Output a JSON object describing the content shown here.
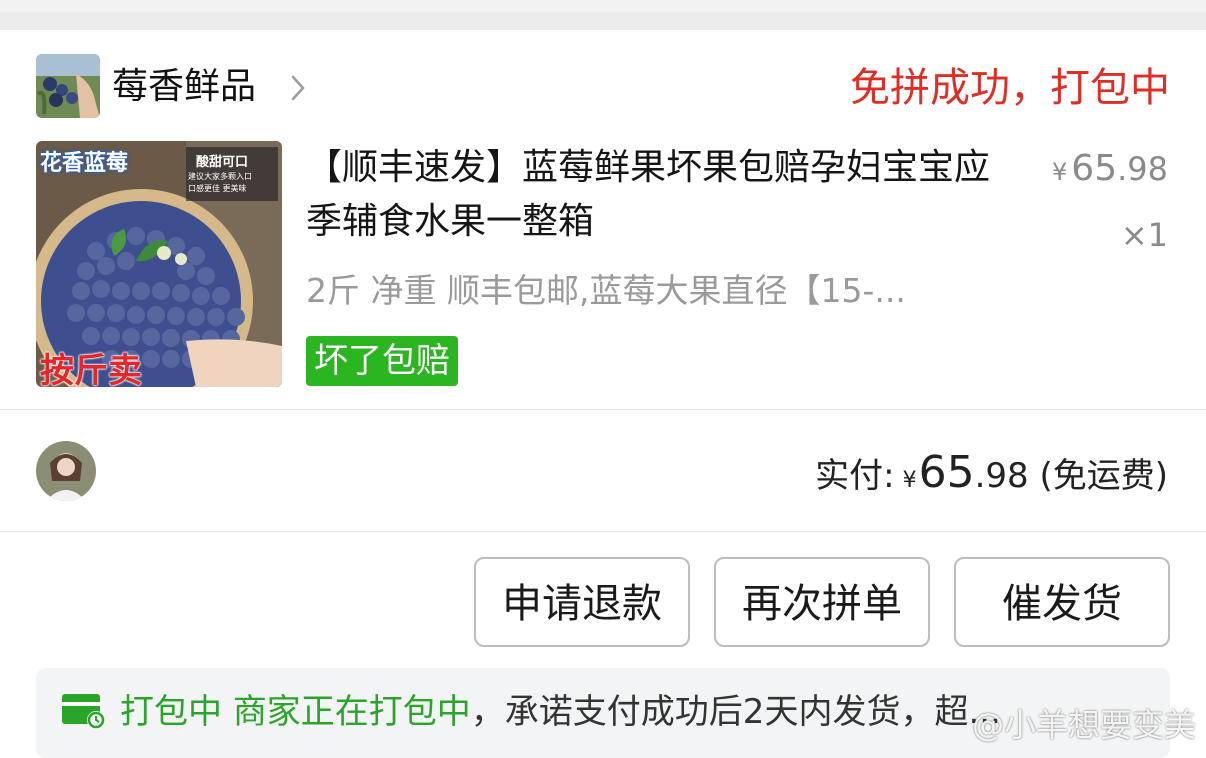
{
  "shop": {
    "name": "莓香鲜品",
    "status": "免拼成功，打包中"
  },
  "product": {
    "image_texts": {
      "top_left": "花香蓝莓",
      "top_right_line1": "酸甜可口",
      "top_right_line2": "建议大家多颗入口",
      "top_right_line3": "口感更佳 更美味",
      "bottom_left": "按斤卖"
    },
    "title": "【顺丰速发】蓝莓鲜果坏果包赔孕妇宝宝应季辅食水果一整箱",
    "price_currency": "¥",
    "price_int": "65",
    "price_dec": ".98",
    "quantity": "×1",
    "spec": "2斤 净重 顺丰包邮,蓝莓大果直径【15-...",
    "tag": "坏了包赔"
  },
  "payment": {
    "label": "实付:",
    "currency": "¥",
    "amount_int": "65",
    "amount_dec": ".98",
    "shipping": "(免运费)"
  },
  "actions": {
    "refund": "申请退款",
    "reorder": "再次拼单",
    "urge": "催发货"
  },
  "notice": {
    "status": "打包中",
    "highlight": "商家正在打包中",
    "rest": "，承诺支付成功后2天内发货，超..."
  },
  "watermark": "@小羊想要变美",
  "colors": {
    "status_red": "#e02e24",
    "tag_green": "#2bb520",
    "notice_green": "#2aa52a"
  }
}
